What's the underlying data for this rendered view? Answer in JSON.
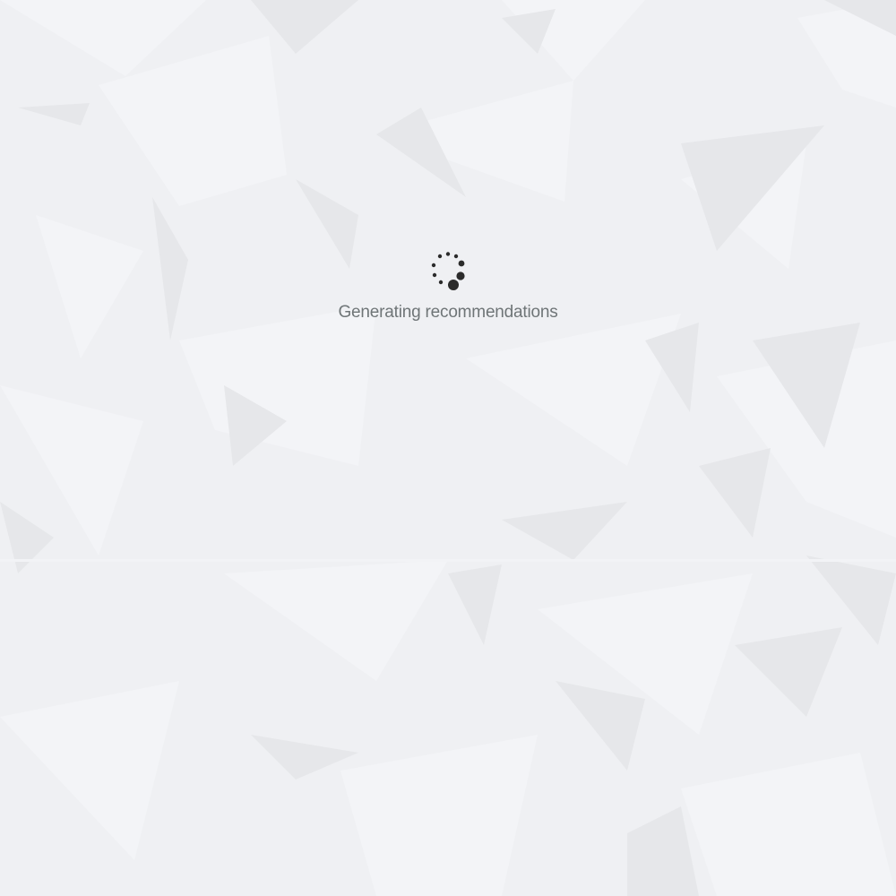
{
  "loading": {
    "message": "Generating recommendations"
  },
  "icons": {
    "spinner": "loading-spinner-icon",
    "background": "low-poly-geometric-pattern"
  },
  "colors": {
    "background": "#eff0f3",
    "facet_light": "#f3f4f7",
    "facet_dark": "#e6e7ea",
    "text": "#6f7577",
    "spinner_dots": "#2b2b2b"
  }
}
